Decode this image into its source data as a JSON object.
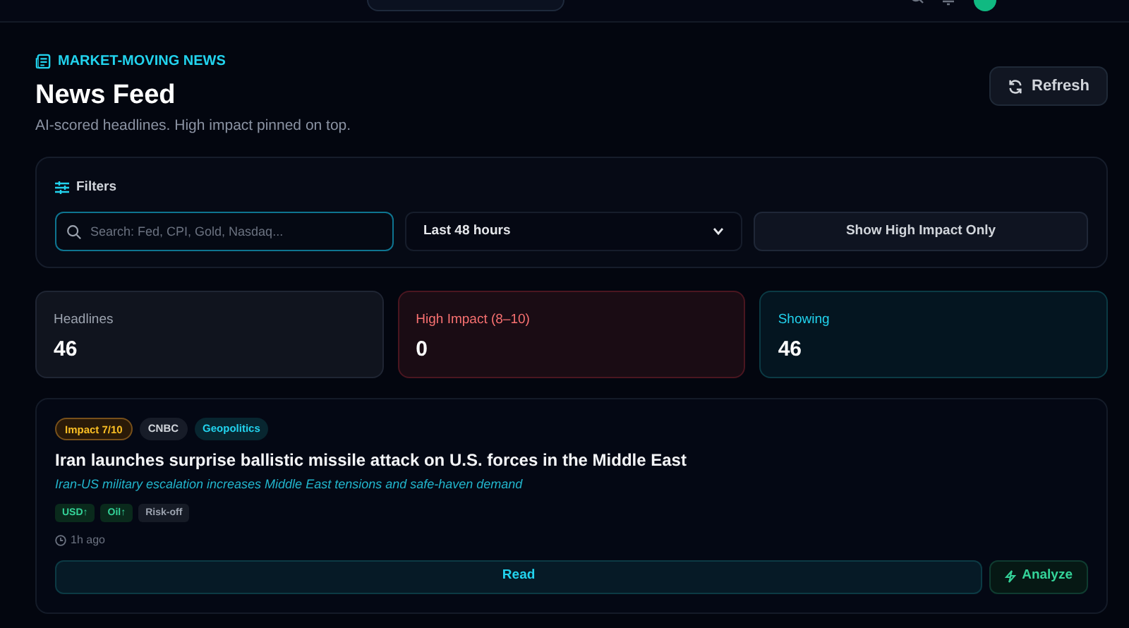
{
  "header": {
    "eyebrow": "MARKET-MOVING NEWS",
    "title": "News Feed",
    "subtitle": "AI-scored headlines. High impact pinned on top.",
    "refresh_button": "Refresh"
  },
  "filters": {
    "title": "Filters",
    "search": {
      "placeholder": "Search: Fed, CPI, Gold, Nasdaq..."
    },
    "range": "Last 48 hours",
    "toggle_button": "Show High Impact Only"
  },
  "stats": [
    {
      "kind": "neutral",
      "label": "Headlines",
      "value": "46"
    },
    {
      "kind": "danger",
      "label": "High Impact (8–10)",
      "value": "0"
    },
    {
      "kind": "accent",
      "label": "Showing",
      "value": "46"
    }
  ],
  "news": [
    {
      "tags": [
        {
          "kind": "impact",
          "text": "Impact 7/10"
        },
        {
          "kind": "source",
          "text": "CNBC"
        },
        {
          "kind": "category",
          "text": "Geopolitics"
        }
      ],
      "headline": "Iran launches surprise ballistic missile attack on U.S. forces in the Middle East",
      "summary": "Iran-US military escalation increases Middle East tensions and safe-haven demand",
      "markets": [
        {
          "kind": "up",
          "text": "USD↑"
        },
        {
          "kind": "up",
          "text": "Oil↑"
        },
        {
          "kind": "neutral",
          "text": "Risk-off"
        }
      ],
      "time": "1h ago",
      "read_button": "Read",
      "analyze_button": "Analyze"
    }
  ]
}
